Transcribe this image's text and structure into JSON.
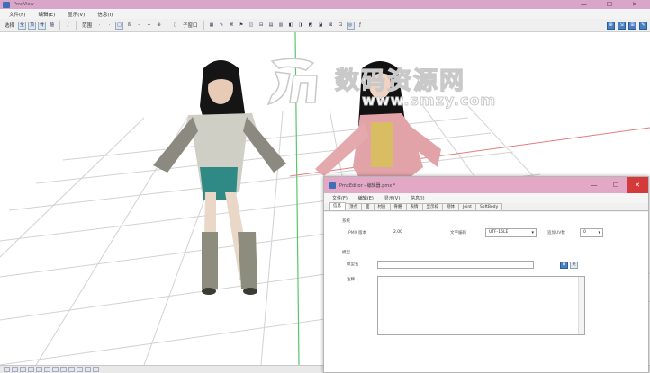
{
  "titlebar": {
    "title": "PmxView",
    "minimize": "—",
    "maximize": "☐",
    "close": "✕"
  },
  "menu": [
    "文件(F)",
    "编辑(E)",
    "显示(V)",
    "信息(I)"
  ],
  "toolbar": {
    "select_label": "选择",
    "select_buttons": [
      "全",
      "顶",
      "骨",
      "轴"
    ],
    "edit_label": "范围",
    "tool_label": "子窗口",
    "right_buttons": [
      "⊕",
      "⇲",
      "⊞",
      "✎"
    ]
  },
  "watermark": {
    "title": "数码资源网",
    "url": "www.smzy.com"
  },
  "dialog": {
    "title": "PmxEditor - 编辑器.pmx *",
    "window_buttons": {
      "minimize": "—",
      "maximize": "☐",
      "close": "✕"
    },
    "menu": [
      "文件(F)",
      "编辑(E)",
      "显示(V)",
      "信息(I)"
    ],
    "tabs": [
      "信息",
      "顶点",
      "面",
      "材质",
      "骨骼",
      "表情",
      "显示枠",
      "刚体",
      "Joint",
      "SoftBody"
    ],
    "active_tab": "信息",
    "system": {
      "section_label": "系统",
      "pmx_version_label": "PMX 版本",
      "pmx_version_value": "2.00",
      "encoding_label": "文字编码",
      "encoding_value": "UTF-16LE",
      "addl_uv_label": "追加UV数",
      "addl_uv_value": "0"
    },
    "model": {
      "section_label": "模型",
      "name_label": "模型名",
      "name_value": "",
      "lang_buttons": [
        "日",
        "英"
      ],
      "comment_label": "注释",
      "comment_value": ""
    }
  },
  "colors": {
    "titlebar": "#d9a5c8",
    "dialog_titlebar": "#e3a8c6",
    "close": "#d43a3a",
    "accent": "#4a7fc2"
  }
}
